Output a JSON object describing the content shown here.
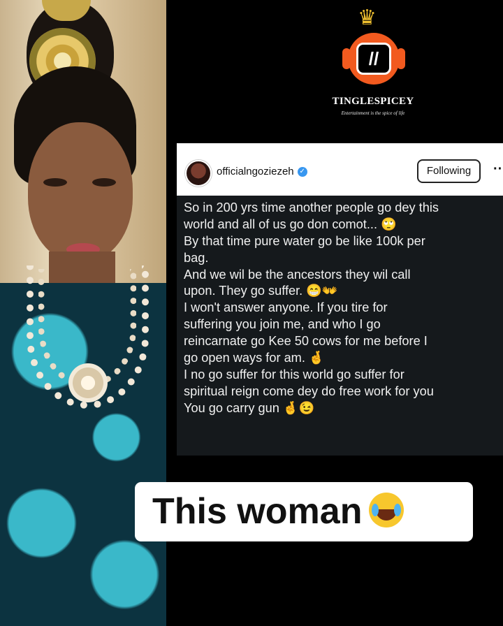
{
  "brand": {
    "name": "TINGLESPICEY",
    "tagline": "Entertainment is the spice of life",
    "logo_mark": "//",
    "colors": {
      "accent": "#f25a1f",
      "crown": "#f2c230"
    }
  },
  "post": {
    "username": "officialngoziezeh",
    "follow_label": "Following",
    "more_label": "··",
    "lines": [
      "So in 200 yrs time another people go dey this",
      "world and all of us go don comot... 🙄",
      "By that time pure water go be like 100k per",
      "bag.",
      "And we wil be the ancestors they wil call",
      "upon. They go suffer. 😁👐",
      "I won't answer anyone. If you tire for",
      "suffering you join me, and who I go",
      "reincarnate go Kee 50 cows for me before I",
      "go open ways for am. 🤞",
      "I no go suffer for this world go suffer for",
      "spiritual reign come dey do free work for you",
      "You go carry gun 🤞😉"
    ]
  },
  "caption": {
    "text": "This woman",
    "emoji_icon": "tears-of-joy-emoji"
  }
}
